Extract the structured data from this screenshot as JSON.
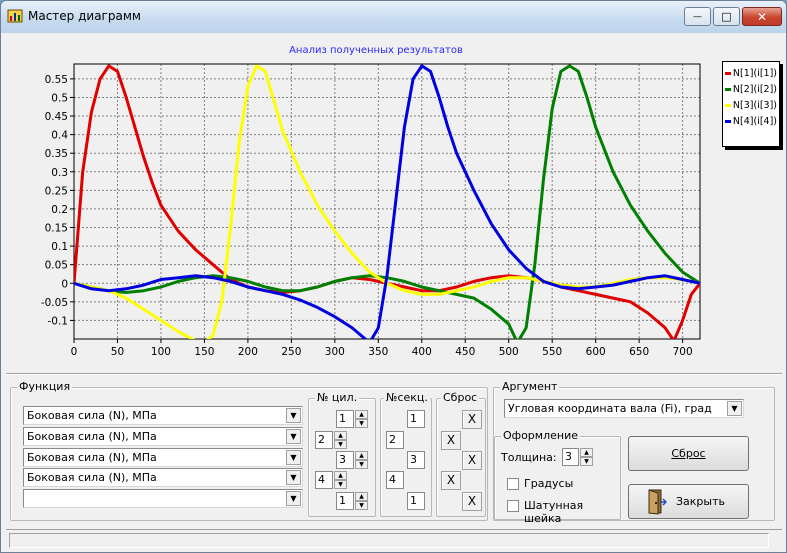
{
  "window": {
    "title": "Мастер диаграмм",
    "minimize": "—",
    "maximize": "□",
    "close": "✕"
  },
  "chart_data": {
    "type": "line",
    "title": "Анализ полученных результатов",
    "xlim": [
      0,
      720
    ],
    "ylim": [
      -0.15,
      0.59
    ],
    "xticks": [
      0,
      50,
      100,
      150,
      200,
      250,
      300,
      350,
      400,
      450,
      500,
      550,
      600,
      650,
      700
    ],
    "yticks": [
      -0.1,
      -0.05,
      0,
      0.05,
      0.1,
      0.15,
      0.2,
      0.25,
      0.3,
      0.35,
      0.4,
      0.45,
      0.5,
      0.55
    ],
    "ytick_labels": [
      "-0.1",
      "-0.05",
      "0",
      "0.05",
      "0.1",
      "0.15",
      "0.2",
      "0.25",
      "0.3",
      "0.35",
      "0.4",
      "0.45",
      "0.5",
      "0.55"
    ],
    "grid": true,
    "legend_position": "top-right",
    "series": [
      {
        "name": "N[1](i[1])",
        "color": "#e00000",
        "x": [
          0,
          10,
          20,
          30,
          40,
          50,
          60,
          70,
          80,
          90,
          100,
          120,
          140,
          160,
          170,
          180,
          200,
          220,
          240,
          260,
          280,
          300,
          320,
          340,
          360,
          380,
          400,
          420,
          440,
          460,
          480,
          500,
          520,
          540,
          560,
          580,
          600,
          620,
          640,
          660,
          680,
          690,
          700,
          710,
          720
        ],
        "y": [
          0,
          0.3,
          0.46,
          0.55,
          0.585,
          0.57,
          0.5,
          0.42,
          0.34,
          0.27,
          0.21,
          0.14,
          0.09,
          0.05,
          0.03,
          0.01,
          -0.01,
          -0.02,
          -0.025,
          -0.02,
          -0.01,
          0.005,
          0.015,
          0.01,
          0,
          -0.01,
          -0.02,
          -0.02,
          -0.01,
          0.005,
          0.015,
          0.02,
          0.015,
          0.005,
          -0.01,
          -0.02,
          -0.03,
          -0.04,
          -0.05,
          -0.08,
          -0.12,
          -0.155,
          -0.1,
          -0.03,
          0
        ]
      },
      {
        "name": "N[2](i[2])",
        "color": "#008000",
        "x": [
          0,
          20,
          40,
          60,
          80,
          100,
          120,
          140,
          160,
          180,
          200,
          220,
          240,
          260,
          280,
          300,
          320,
          340,
          360,
          380,
          400,
          420,
          440,
          460,
          480,
          500,
          510,
          520,
          530,
          540,
          550,
          560,
          570,
          580,
          590,
          600,
          620,
          640,
          660,
          680,
          700,
          720
        ],
        "y": [
          0,
          -0.01,
          -0.02,
          -0.025,
          -0.02,
          -0.01,
          0.005,
          0.015,
          0.02,
          0.015,
          0.005,
          -0.01,
          -0.02,
          -0.02,
          -0.01,
          0.005,
          0.015,
          0.02,
          0.015,
          0.005,
          -0.01,
          -0.02,
          -0.03,
          -0.04,
          -0.07,
          -0.11,
          -0.16,
          -0.12,
          0.05,
          0.28,
          0.47,
          0.57,
          0.585,
          0.57,
          0.5,
          0.42,
          0.3,
          0.21,
          0.14,
          0.08,
          0.03,
          0
        ]
      },
      {
        "name": "N[3](i[3])",
        "color": "#ffff00",
        "x": [
          0,
          20,
          40,
          60,
          80,
          100,
          120,
          140,
          150,
          160,
          170,
          180,
          190,
          200,
          210,
          220,
          230,
          240,
          260,
          280,
          300,
          320,
          340,
          360,
          380,
          400,
          420,
          440,
          460,
          480,
          500,
          520,
          540,
          560,
          580,
          600,
          620,
          640,
          660,
          680,
          700,
          720
        ],
        "y": [
          0,
          -0.01,
          -0.02,
          -0.04,
          -0.07,
          -0.1,
          -0.13,
          -0.155,
          -0.16,
          -0.14,
          -0.05,
          0.15,
          0.38,
          0.53,
          0.585,
          0.57,
          0.49,
          0.41,
          0.3,
          0.21,
          0.14,
          0.08,
          0.03,
          0,
          -0.02,
          -0.03,
          -0.03,
          -0.02,
          -0.01,
          0.005,
          0.015,
          0.015,
          0.005,
          -0.005,
          -0.01,
          -0.01,
          0,
          0.01,
          0.015,
          0.015,
          0.01,
          0
        ]
      },
      {
        "name": "N[4](i[4])",
        "color": "#0000e0",
        "x": [
          0,
          20,
          40,
          60,
          80,
          100,
          120,
          140,
          160,
          180,
          200,
          220,
          240,
          260,
          280,
          300,
          320,
          340,
          350,
          360,
          370,
          380,
          390,
          400,
          410,
          420,
          430,
          440,
          460,
          480,
          500,
          520,
          540,
          560,
          580,
          600,
          620,
          640,
          660,
          680,
          700,
          720
        ],
        "y": [
          0,
          -0.015,
          -0.02,
          -0.015,
          -0.005,
          0.01,
          0.015,
          0.02,
          0.015,
          0.005,
          -0.01,
          -0.02,
          -0.03,
          -0.045,
          -0.065,
          -0.09,
          -0.12,
          -0.16,
          -0.12,
          0.02,
          0.22,
          0.42,
          0.55,
          0.585,
          0.57,
          0.5,
          0.42,
          0.35,
          0.25,
          0.16,
          0.09,
          0.04,
          0.005,
          -0.01,
          -0.015,
          -0.01,
          -0.005,
          0.005,
          0.015,
          0.02,
          0.01,
          0
        ]
      }
    ]
  },
  "function_group": {
    "label": "Функция",
    "functions": [
      "Боковая сила (N), МПа",
      "Боковая сила (N), МПа",
      "Боковая сила (N), МПа",
      "Боковая сила (N), МПа",
      ""
    ]
  },
  "cyl_group": {
    "label": "№ цил.",
    "values": [
      "1",
      "2",
      "3",
      "4",
      "1"
    ]
  },
  "sect_group": {
    "label": "№секц.",
    "values": [
      "1",
      "2",
      "3",
      "4",
      "1"
    ]
  },
  "reset_group": {
    "label": "Сброс",
    "x": "X"
  },
  "argument_group": {
    "label": "Аргумент",
    "value": "Угловая координата вала (Fi), град"
  },
  "design_group": {
    "label": "Оформление",
    "thickness_label": "Толщина:",
    "thickness_value": "3",
    "degrees_label": "Градусы",
    "crank_label": "Шатунная шейка"
  },
  "buttons": {
    "reset": "Сброс",
    "close": "Закрыть"
  }
}
